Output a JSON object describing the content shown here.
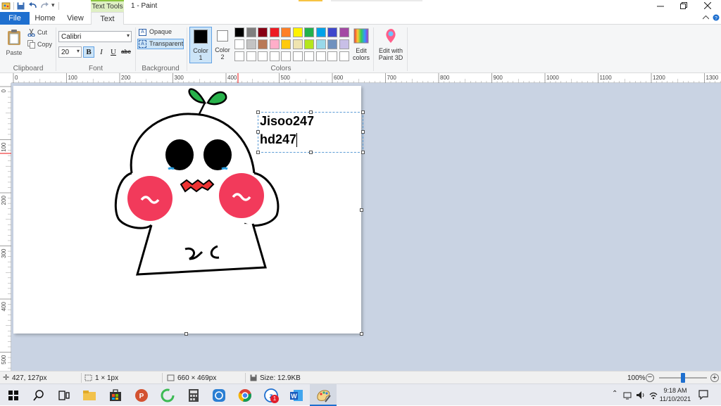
{
  "titlebar": {
    "contextual_tab": "Text Tools",
    "title": "1 - Paint"
  },
  "tabs": {
    "file": "File",
    "home": "Home",
    "view": "View",
    "text": "Text"
  },
  "clipboard": {
    "paste": "Paste",
    "cut": "Cut",
    "copy": "Copy",
    "group": "Clipboard"
  },
  "font": {
    "family": "Calibri",
    "size": "20",
    "bold": "B",
    "italic": "I",
    "underline": "U",
    "strike": "abc",
    "group": "Font"
  },
  "background": {
    "opaque": "Opaque",
    "transparent": "Transparent",
    "group": "Background"
  },
  "colors": {
    "color1_label": "Color",
    "color1_num": "1",
    "color2_label": "Color",
    "color2_num": "2",
    "edit_colors_1": "Edit",
    "edit_colors_2": "colors",
    "paint3d_1": "Edit with",
    "paint3d_2": "Paint 3D",
    "group": "Colors",
    "color1": "#000000",
    "color2": "#ffffff",
    "palette_row1": [
      "#000000",
      "#7f7f7f",
      "#880015",
      "#ed1c24",
      "#ff7f27",
      "#fff200",
      "#22b14c",
      "#00a2e8",
      "#3f48cc",
      "#a349a4"
    ],
    "palette_row2": [
      "#ffffff",
      "#c3c3c3",
      "#b97a57",
      "#ffaec9",
      "#ffc90e",
      "#efe4b0",
      "#b5e61d",
      "#99d9ea",
      "#7092be",
      "#c8bfe7"
    ]
  },
  "ruler": {
    "h_ticks": [
      "0",
      "100",
      "200",
      "300",
      "400",
      "500",
      "600",
      "700",
      "800",
      "900",
      "1000",
      "1100",
      "1200",
      "1300"
    ],
    "v_ticks": [
      "0",
      "100",
      "200",
      "300",
      "400",
      "500"
    ]
  },
  "drawing": {
    "text_line1": "Jisoo247",
    "text_line2": "hd247"
  },
  "status": {
    "cursor_pos": "427, 127px",
    "selection_size": "1 × 1px",
    "image_size": "660 × 469px",
    "file_size": "Size: 12.9KB",
    "zoom": "100%",
    "zoom_level_fraction": 0.5
  },
  "taskbar": {
    "time": "9:18 AM",
    "date": "11/10/2021",
    "notification_badge": "1"
  }
}
